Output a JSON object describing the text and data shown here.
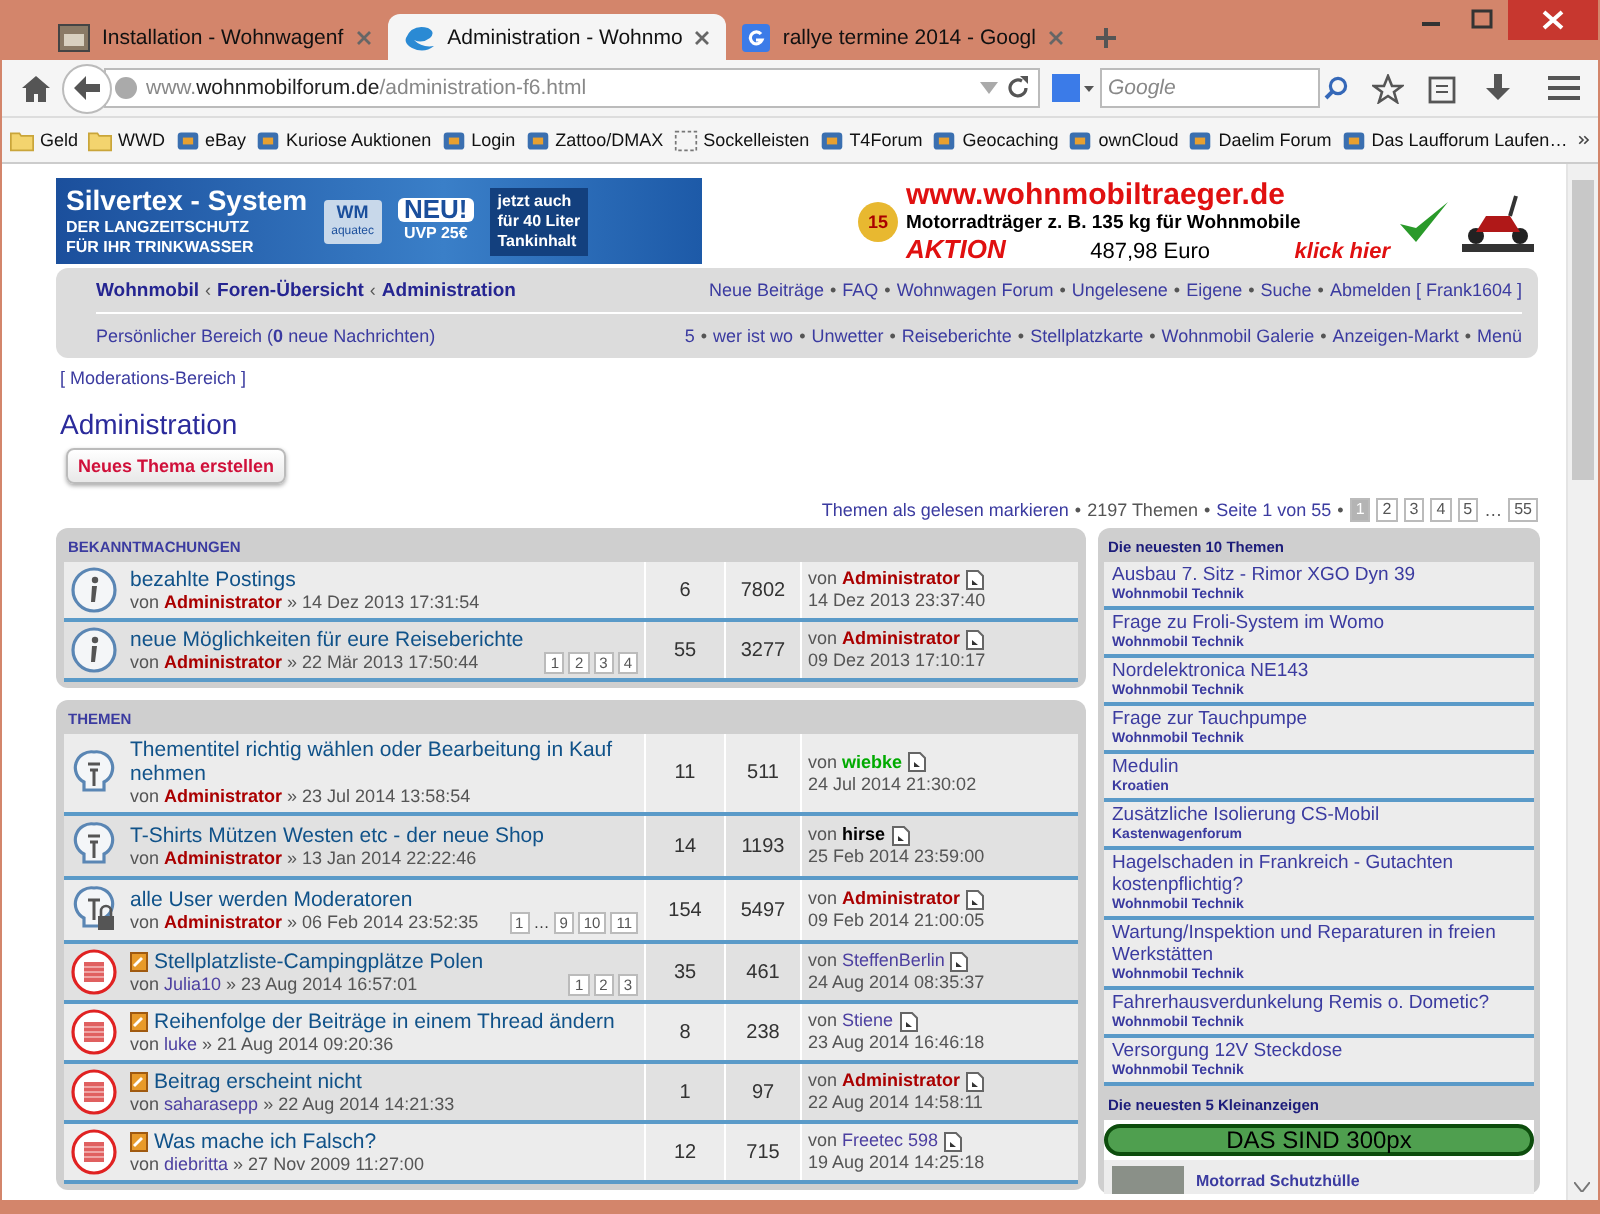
{
  "browser": {
    "tabs": [
      {
        "title": "Installation - Wohnwagenf",
        "kind": "photo",
        "selected": false
      },
      {
        "title": "Administration - Wohnmo",
        "kind": "site",
        "selected": true
      },
      {
        "title": "rallye termine 2014 - Googl",
        "kind": "google",
        "selected": false
      }
    ],
    "address": {
      "prefix": "www.",
      "domain": "wohnmobilforum.de",
      "path": "/administration-f6.html"
    },
    "search": {
      "placeholder": "Google"
    },
    "bookmarks": [
      {
        "label": "Geld",
        "kind": "folder"
      },
      {
        "label": "WWD",
        "kind": "folder"
      },
      {
        "label": "eBay",
        "kind": "site"
      },
      {
        "label": "Kuriose Auktionen",
        "kind": "site"
      },
      {
        "label": "Login",
        "kind": "site"
      },
      {
        "label": "Zattoo/DMAX",
        "kind": "site"
      },
      {
        "label": "Sockelleisten",
        "kind": "blank"
      },
      {
        "label": "T4Forum",
        "kind": "site"
      },
      {
        "label": "Geocaching",
        "kind": "site"
      },
      {
        "label": "ownCloud",
        "kind": "site"
      },
      {
        "label": "Daelim Forum",
        "kind": "site"
      },
      {
        "label": "Das Laufforum Laufen…",
        "kind": "site"
      }
    ]
  },
  "ads": {
    "left": {
      "headline": "Silvertex - System",
      "tagline": [
        "DER LANGZEITSCHUTZ",
        "FÜR IHR TRINKWASSER"
      ],
      "brand": "WM",
      "brand_sub": "aquatec",
      "badge": "NEU!",
      "price": "UVP 25€",
      "note": [
        "jetzt auch",
        "für 40 Liter",
        "Tankinhalt"
      ]
    },
    "right": {
      "badge": "15",
      "url": "www.wohnmobiltraeger.de",
      "text": "Motorradträger z. B. 135 kg für Wohnmobile",
      "promo": "AKTION",
      "price": "487,98 Euro",
      "cta": "klick hier"
    }
  },
  "nav": {
    "breadcrumbs": [
      {
        "label": "Wohnmobil"
      },
      {
        "separator": "‹",
        "label": "Foren-Übersicht"
      },
      {
        "separator": "‹",
        "label": "Administration"
      }
    ],
    "links": [
      {
        "label": "Neue Beiträge"
      },
      {
        "separator": "•",
        "label": "FAQ"
      },
      {
        "separator": "•",
        "label": "Wohnwagen Forum"
      },
      {
        "separator": "•",
        "label": "Ungelesene"
      },
      {
        "separator": "•",
        "label": "Eigene"
      },
      {
        "separator": "•",
        "label": "Suche"
      },
      {
        "separator": "•",
        "label": "Abmelden [ Frank1604 ]"
      }
    ],
    "personal": "Persönlicher Bereich (**0** neue Nachrichten)",
    "links2": [
      {
        "label": "5"
      },
      {
        "separator": "•",
        "label": "wer ist wo"
      },
      {
        "separator": "•",
        "label": "Unwetter"
      },
      {
        "separator": "•",
        "label": "Reiseberichte"
      },
      {
        "separator": "•",
        "label": "Stellplatzkarte"
      },
      {
        "separator": "•",
        "label": "Wohnmobil Galerie"
      },
      {
        "separator": "•",
        "label": "Anzeigen-Markt"
      },
      {
        "separator": "•",
        "label": "Menü"
      }
    ]
  },
  "moderation_link": "[ Moderations-Bereich ]",
  "page_title": "Administration",
  "new_topic_button": "Neues Thema erstellen",
  "pagination": {
    "mark_read": "Themen als gelesen markieren",
    "sep1": "•",
    "count": "2197 Themen",
    "sep2": "•",
    "page_of": "Seite 1 von 55",
    "sep3": "•",
    "pages": [
      {
        "label": "1",
        "kind": "page",
        "selected": true
      },
      {
        "label": "2",
        "kind": "page",
        "selected": false
      },
      {
        "label": "3",
        "kind": "page",
        "selected": false
      },
      {
        "label": "4",
        "kind": "page",
        "selected": false
      },
      {
        "label": "5",
        "kind": "page",
        "selected": false
      },
      {
        "label": "…",
        "kind": "gap",
        "selected": false
      },
      {
        "label": "55",
        "kind": "page",
        "selected": false
      }
    ]
  },
  "sections": [
    {
      "title": "BEKANNTMACHUNGEN",
      "topics": [
        {
          "kind": "announcement",
          "title": "bezahlte Postings",
          "by": "von",
          "author": {
            "name": "Administrator",
            "color": "#aa0000",
            "highlighted": true
          },
          "date": "» 14 Dez 2013 17:31:54",
          "replies": "6",
          "views": "7802",
          "last_by": "von",
          "last_author": {
            "name": "Administrator",
            "color": "#aa0000",
            "highlighted": true
          },
          "last_date": "14 Dez 2013 23:37:40"
        },
        {
          "kind": "announcement",
          "title": "neue Möglichkeiten für eure Reiseberichte",
          "by": "von",
          "author": {
            "name": "Administrator",
            "color": "#aa0000",
            "highlighted": true
          },
          "date": "» 22 Mär 2013 17:50:44",
          "pages": [
            {
              "kind": "page",
              "label": "1"
            },
            {
              "kind": "page",
              "label": "2"
            },
            {
              "kind": "page",
              "label": "3"
            },
            {
              "kind": "page",
              "label": "4"
            }
          ],
          "replies": "55",
          "views": "3277",
          "last_by": "von",
          "last_author": {
            "name": "Administrator",
            "color": "#aa0000",
            "highlighted": true
          },
          "last_date": "09 Dez 2013 17:10:17"
        }
      ]
    },
    {
      "title": "THEMEN",
      "topics": [
        {
          "kind": "sticky",
          "title": "Thementitel richtig wählen oder Bearbeitung in Kauf nehmen",
          "by": "von",
          "author": {
            "name": "Administrator",
            "color": "#aa0000",
            "highlighted": true
          },
          "date": "» 23 Jul 2014 13:58:54",
          "replies": "11",
          "views": "511",
          "last_by": "von",
          "last_author": {
            "name": "wiebke",
            "color": "#00aa00",
            "highlighted": true
          },
          "last_date": "24 Jul 2014 21:30:02"
        },
        {
          "kind": "sticky",
          "title": "T-Shirts Mützen Westen etc - der neue Shop",
          "by": "von",
          "author": {
            "name": "Administrator",
            "color": "#aa0000",
            "highlighted": true
          },
          "date": "» 13 Jan 2014 22:22:46",
          "replies": "14",
          "views": "1193",
          "last_by": "von",
          "last_author": {
            "name": "hirse",
            "color": "#000000",
            "highlighted": true
          },
          "last_date": "25 Feb 2014 23:59:00"
        },
        {
          "kind": "sticky-locked",
          "title": "alle User werden Moderatoren",
          "by": "von",
          "author": {
            "name": "Administrator",
            "color": "#aa0000",
            "highlighted": true
          },
          "date": "» 06 Feb 2014 23:52:35",
          "pages": [
            {
              "kind": "page",
              "label": "1"
            },
            {
              "kind": "gap",
              "label": "…"
            },
            {
              "kind": "page",
              "label": "9"
            },
            {
              "kind": "page",
              "label": "10"
            },
            {
              "kind": "page",
              "label": "11"
            }
          ],
          "replies": "154",
          "views": "5497",
          "last_by": "von",
          "last_author": {
            "name": "Administrator",
            "color": "#aa0000",
            "highlighted": true
          },
          "last_date": "09 Feb 2014 21:00:05"
        },
        {
          "kind": "hot",
          "title": "Stellplatzliste-Campingplätze Polen",
          "by": "von",
          "author": {
            "name": "Julia10",
            "color": "#4c3fa0",
            "highlighted": false
          },
          "date": "» 23 Aug 2014 16:57:01",
          "pages": [
            {
              "kind": "page",
              "label": "1"
            },
            {
              "kind": "page",
              "label": "2"
            },
            {
              "kind": "page",
              "label": "3"
            }
          ],
          "replies": "35",
          "views": "461",
          "last_by": "von",
          "last_author": {
            "name": "SteffenBerlin",
            "color": "#4c3fa0",
            "highlighted": false
          },
          "last_date": "24 Aug 2014 08:35:37"
        },
        {
          "kind": "hot",
          "title": "Reihenfolge der Beiträge in einem Thread ändern",
          "by": "von",
          "author": {
            "name": "luke",
            "color": "#4c3fa0",
            "highlighted": false
          },
          "date": "» 21 Aug 2014 09:20:36",
          "replies": "8",
          "views": "238",
          "last_by": "von",
          "last_author": {
            "name": "Stiene",
            "color": "#4c3fa0",
            "highlighted": false
          },
          "last_date": "23 Aug 2014 16:46:18"
        },
        {
          "kind": "hot",
          "title": "Beitrag erscheint nicht",
          "by": "von",
          "author": {
            "name": "saharasepp",
            "color": "#4c3fa0",
            "highlighted": false
          },
          "date": "» 22 Aug 2014 14:21:33",
          "replies": "1",
          "views": "97",
          "last_by": "von",
          "last_author": {
            "name": "Administrator",
            "color": "#aa0000",
            "highlighted": true
          },
          "last_date": "22 Aug 2014 14:58:11"
        },
        {
          "kind": "hot",
          "title": "Was mache ich Falsch?",
          "by": "von",
          "author": {
            "name": "diebritta",
            "color": "#4c3fa0",
            "highlighted": false
          },
          "date": "» 27 Nov 2009 11:27:00",
          "replies": "12",
          "views": "715",
          "last_by": "von",
          "last_author": {
            "name": "Freetec 598",
            "color": "#4c3fa0",
            "highlighted": false
          },
          "last_date": "19 Aug 2014 14:25:18"
        }
      ]
    }
  ],
  "sidebar": {
    "title": "Die neuesten 10 Themen",
    "topics": [
      {
        "title": "Ausbau 7. Sitz - Rimor XGO Dyn 39",
        "forum": "Wohnmobil Technik"
      },
      {
        "title": "Frage zu Froli-System im Womo",
        "forum": "Wohnmobil Technik"
      },
      {
        "title": "Nordelektronica NE143",
        "forum": "Wohnmobil Technik"
      },
      {
        "title": "Frage zur Tauchpumpe",
        "forum": "Wohnmobil Technik"
      },
      {
        "title": "Medulin",
        "forum": "Kroatien"
      },
      {
        "title": "Zusätzliche Isolierung CS-Mobil",
        "forum": "Kastenwagenforum"
      },
      {
        "title": "Hagelschaden in Frankreich - Gutachten kostenpflichtig?",
        "forum": "Wohnmobil Technik"
      },
      {
        "title": "Wartung/Inspektion und Reparaturen in freien Werkstätten",
        "forum": "Wohnmobil Technik"
      },
      {
        "title": "Fahrerhausverdunkelung Remis o. Dometic?",
        "forum": "Wohnmobil Technik"
      },
      {
        "title": "Versorgung 12V Steckdose",
        "forum": "Wohnmobil Technik"
      }
    ],
    "classifieds_title": "Die neuesten 5 Kleinanzeigen",
    "banner": "DAS SIND 300px",
    "classifieds": [
      {
        "title": "Motorrad Schutzhülle"
      }
    ]
  }
}
